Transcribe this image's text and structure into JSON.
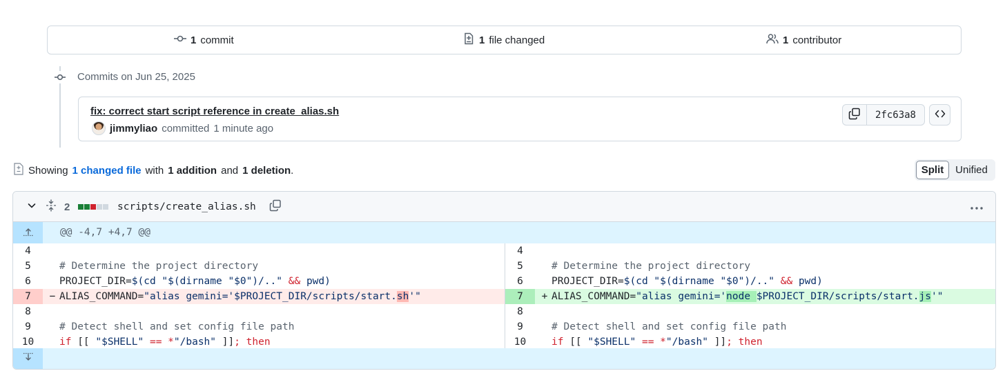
{
  "summary": {
    "commits_count": "1",
    "commits_label": "commit",
    "files_count": "1",
    "files_label": "file changed",
    "contributors_count": "1",
    "contributors_label": "contributor"
  },
  "timeline": {
    "date_label": "Commits on Jun 25, 2025"
  },
  "commit": {
    "title": "fix: correct start script reference in create_alias.sh",
    "author": "jimmyliao",
    "action": "committed",
    "time": "1 minute ago",
    "sha": "2fc63a8"
  },
  "showing": {
    "prefix": "Showing",
    "changed_files": "1 changed file",
    "with": "with",
    "additions": "1 addition",
    "and": "and",
    "deletions": "1 deletion",
    "period": "."
  },
  "view_toggle": {
    "split": "Split",
    "unified": "Unified"
  },
  "diff": {
    "change_count": "2",
    "filename": "scripts/create_alias.sh",
    "hunk_header": "@@ -4,7 +4,7 @@",
    "stat_colors": [
      "#1a7f37",
      "#1a7f37",
      "#cf222e",
      "#d1d9e0",
      "#d1d9e0"
    ],
    "left": [
      {
        "num": "4",
        "type": "context",
        "parts": []
      },
      {
        "num": "5",
        "type": "context",
        "parts": [
          {
            "c": "cmt",
            "t": "# Determine the project directory"
          }
        ]
      },
      {
        "num": "6",
        "type": "context",
        "parts": [
          {
            "c": "plain",
            "t": "PROJECT_DIR="
          },
          {
            "c": "var",
            "t": "$(cd \"$(dirname \"$0\")/..\" "
          },
          {
            "c": "key",
            "t": "&&"
          },
          {
            "c": "var",
            "t": " pwd)"
          }
        ]
      },
      {
        "num": "7",
        "type": "del",
        "marker": "−",
        "parts": [
          {
            "c": "plain",
            "t": "ALIAS_COMMAND="
          },
          {
            "c": "str",
            "t": "\"alias gemini='$PROJECT_DIR/scripts/start."
          },
          {
            "c": "str hl-del",
            "t": "sh"
          },
          {
            "c": "str",
            "t": "'\""
          }
        ]
      },
      {
        "num": "8",
        "type": "context",
        "parts": []
      },
      {
        "num": "9",
        "type": "context",
        "parts": [
          {
            "c": "cmt",
            "t": "# Detect shell and set config file path"
          }
        ]
      },
      {
        "num": "10",
        "type": "context",
        "parts": [
          {
            "c": "key",
            "t": "if"
          },
          {
            "c": "plain",
            "t": " [[ "
          },
          {
            "c": "str",
            "t": "\"$SHELL\""
          },
          {
            "c": "plain",
            "t": " "
          },
          {
            "c": "key",
            "t": "=="
          },
          {
            "c": "plain",
            "t": " "
          },
          {
            "c": "key",
            "t": "*"
          },
          {
            "c": "str",
            "t": "\"/bash\""
          },
          {
            "c": "plain",
            "t": " ]]"
          },
          {
            "c": "key",
            "t": "; then"
          }
        ]
      }
    ],
    "right": [
      {
        "num": "4",
        "type": "context",
        "parts": []
      },
      {
        "num": "5",
        "type": "context",
        "parts": [
          {
            "c": "cmt",
            "t": "# Determine the project directory"
          }
        ]
      },
      {
        "num": "6",
        "type": "context",
        "parts": [
          {
            "c": "plain",
            "t": "PROJECT_DIR="
          },
          {
            "c": "var",
            "t": "$(cd \"$(dirname \"$0\")/..\" "
          },
          {
            "c": "key",
            "t": "&&"
          },
          {
            "c": "var",
            "t": " pwd)"
          }
        ]
      },
      {
        "num": "7",
        "type": "add",
        "marker": "+",
        "parts": [
          {
            "c": "plain",
            "t": "ALIAS_COMMAND="
          },
          {
            "c": "str",
            "t": "\"alias gemini='"
          },
          {
            "c": "str hl-add",
            "t": "node "
          },
          {
            "c": "str",
            "t": "$PROJECT_DIR/scripts/start."
          },
          {
            "c": "str hl-add",
            "t": "js"
          },
          {
            "c": "str",
            "t": "'\""
          }
        ]
      },
      {
        "num": "8",
        "type": "context",
        "parts": []
      },
      {
        "num": "9",
        "type": "context",
        "parts": [
          {
            "c": "cmt",
            "t": "# Detect shell and set config file path"
          }
        ]
      },
      {
        "num": "10",
        "type": "context",
        "parts": [
          {
            "c": "key",
            "t": "if"
          },
          {
            "c": "plain",
            "t": " [[ "
          },
          {
            "c": "str",
            "t": "\"$SHELL\""
          },
          {
            "c": "plain",
            "t": " "
          },
          {
            "c": "key",
            "t": "=="
          },
          {
            "c": "plain",
            "t": " "
          },
          {
            "c": "key",
            "t": "*"
          },
          {
            "c": "str",
            "t": "\"/bash\""
          },
          {
            "c": "plain",
            "t": " ]]"
          },
          {
            "c": "key",
            "t": "; then"
          }
        ]
      }
    ]
  },
  "icons": {
    "commit": "git-commit-icon",
    "file_diff": "file-diff-icon",
    "people": "people-icon",
    "copy": "copy-icon",
    "code": "code-icon",
    "chevron": "chevron-down-icon",
    "fold": "fold-icon",
    "kebab": "kebab-horizontal-icon",
    "expand_up": "expand-up-icon",
    "expand_down": "expand-down-icon"
  }
}
